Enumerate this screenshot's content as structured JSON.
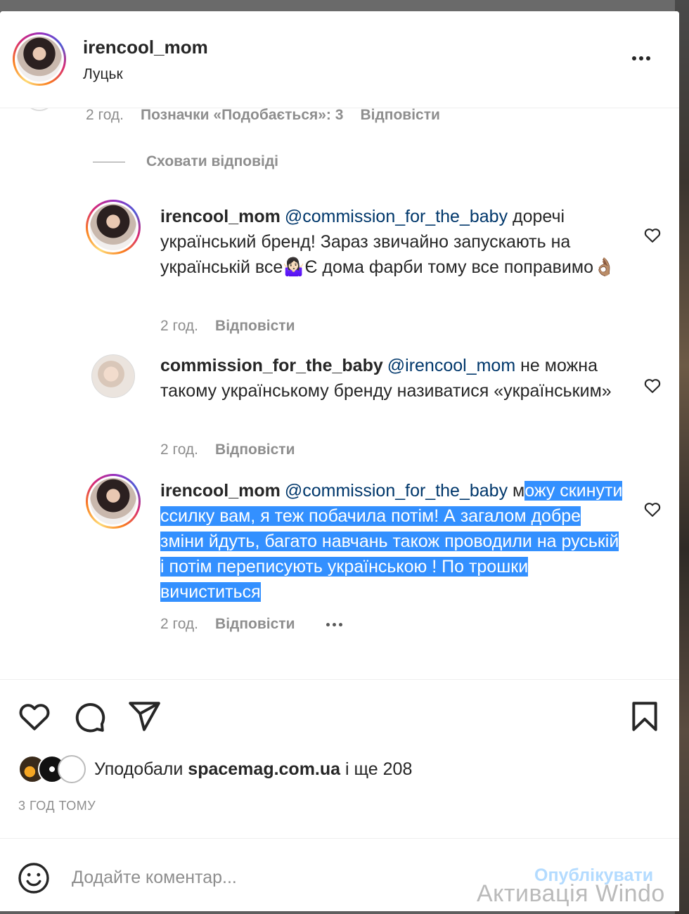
{
  "post": {
    "username": "irencool_mom",
    "location": "Луцьк"
  },
  "previous_comment": {
    "time": "2 год.",
    "likes": "Позначки «Подобається»: 3",
    "reply": "Відповісти"
  },
  "hide_replies": "Сховати відповіді",
  "replies": [
    {
      "username": "irencool_mom",
      "mention": "@commission_for_the_baby",
      "text": "доречі український бренд! Зараз звичайно запускають на українській все🤷🏻‍♀️Є дома фарби тому все поправимо👌🏽",
      "time": "2 год.",
      "reply": "Відповісти"
    },
    {
      "username": "commission_for_the_baby",
      "mention": "@irencool_mom",
      "text": "не можна такому українському бренду називатися «українським»",
      "time": "2 год.",
      "reply": "Відповісти"
    },
    {
      "username": "irencool_mom",
      "mention": "@commission_for_the_baby",
      "text_unselected": "м",
      "text_selected": "ожу скинути ссилку вам, я теж побачила потім! А загалом добре зміни йдуть, багато навчань також проводили на руській і потім переписують українською ! По трошки вичиститься",
      "time": "2 год.",
      "reply": "Відповісти"
    }
  ],
  "likes": {
    "prefix": "Уподобали",
    "user": "spacemag.com.ua",
    "suffix": "і ще 208"
  },
  "timestamp": "3 ГОД ТОМУ",
  "comment_box": {
    "placeholder": "Додайте коментар...",
    "publish": "Опублікувати"
  },
  "watermark": "Активація Windo",
  "colors": {
    "mention": "#00376b",
    "muted": "#8e8e8e",
    "selection": "#3390ff",
    "publish_disabled": "#b3dbff"
  }
}
